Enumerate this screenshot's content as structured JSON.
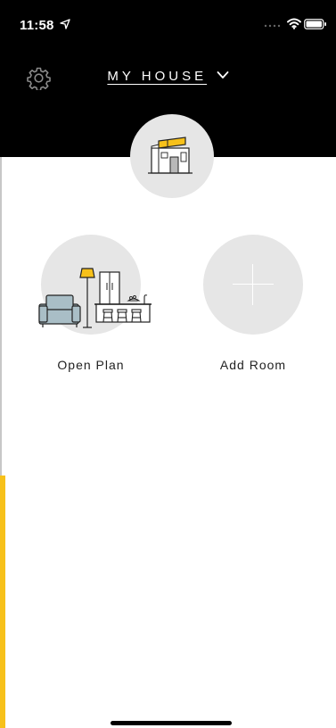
{
  "status_bar": {
    "time": "11:58"
  },
  "header": {
    "title": "MY HOUSE",
    "settings_icon": "gear-icon",
    "dropdown_icon": "chevron-down-icon",
    "house_icon": "house-icon"
  },
  "rooms": [
    {
      "label": "Open Plan",
      "icon": "open-plan-room-icon"
    },
    {
      "label": "Add Room",
      "icon": "plus-icon"
    }
  ],
  "colors": {
    "header_bg": "#000000",
    "circle_bg": "#e6e6e6",
    "accent_yellow": "#f7c11a",
    "sofa_blue": "#a9bec6"
  }
}
